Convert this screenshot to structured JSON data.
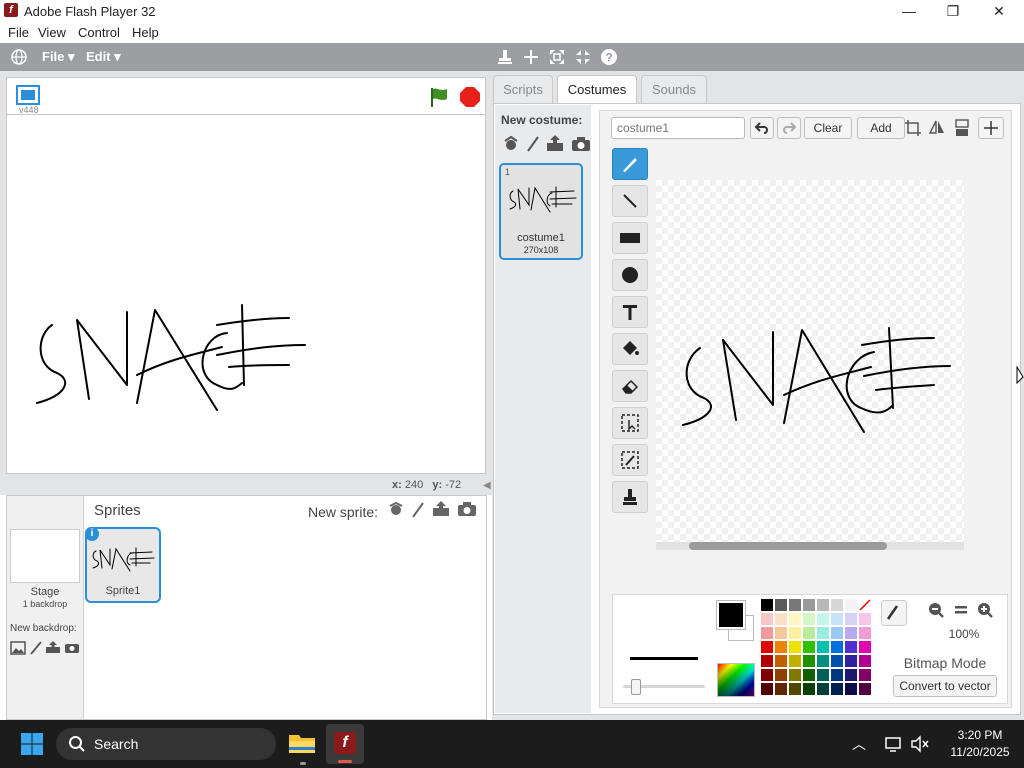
{
  "window": {
    "title": "Adobe Flash Player 32",
    "min": "—",
    "max": "❐",
    "close": "✕"
  },
  "menu": [
    "File",
    "View",
    "Control",
    "Help"
  ],
  "scratch_bar": {
    "file": "File ▾",
    "edit": "Edit ▾"
  },
  "stage": {
    "version": "v448",
    "x_label": "x:",
    "x_value": "240",
    "y_label": "y:",
    "y_value": "-72"
  },
  "sprites": {
    "title": "Sprites",
    "new_sprite_label": "New sprite:",
    "stage_label": "Stage",
    "stage_backdrops": "1 backdrop",
    "new_backdrop_label": "New backdrop:",
    "sprite_name": "Sprite1",
    "info_badge": "i"
  },
  "tabs": [
    "Scripts",
    "Costumes",
    "Sounds"
  ],
  "active_tab": "Costumes",
  "costumes": {
    "new_costume_label": "New costume:",
    "items": [
      {
        "number": "1",
        "name": "costume1",
        "size": "270x108"
      }
    ]
  },
  "editor": {
    "name_placeholder": "costume1",
    "clear_label": "Clear",
    "add_label": "Add",
    "zoom_percent": "100%",
    "mode_label": "Bitmap Mode",
    "convert_label": "Convert to vector"
  },
  "palette_colors": [
    [
      "#000000",
      "#5a5a5a",
      "#787878",
      "#9a9a9a",
      "#b8b8b8",
      "#d6d6d6",
      "#f4f4f4",
      "none"
    ],
    [
      "#f7c6c6",
      "#fbe0c6",
      "#fff6c6",
      "#d8f5c6",
      "#c6f5ec",
      "#c6e2f8",
      "#d8d0f5",
      "#f5c6e8"
    ],
    [
      "#f29b9b",
      "#f8c79b",
      "#fff09b",
      "#b9ec9b",
      "#9bece0",
      "#9bc9f2",
      "#b9a9ee",
      "#ee9bd6"
    ],
    [
      "#e00000",
      "#f08000",
      "#f0e000",
      "#30c000",
      "#00c0b0",
      "#0070e0",
      "#5030d0",
      "#e000b0"
    ],
    [
      "#b00000",
      "#c06000",
      "#c0b000",
      "#209000",
      "#009080",
      "#0050b0",
      "#3020a0",
      "#b00090"
    ],
    [
      "#800000",
      "#904000",
      "#807800",
      "#106000",
      "#006058",
      "#003880",
      "#201870",
      "#800068"
    ],
    [
      "#500000",
      "#602800",
      "#504800",
      "#084000",
      "#004038",
      "#002050",
      "#100c48",
      "#500040"
    ]
  ],
  "taskbar": {
    "search": "Search",
    "time": "3:20 PM",
    "date": "11/20/2025"
  }
}
